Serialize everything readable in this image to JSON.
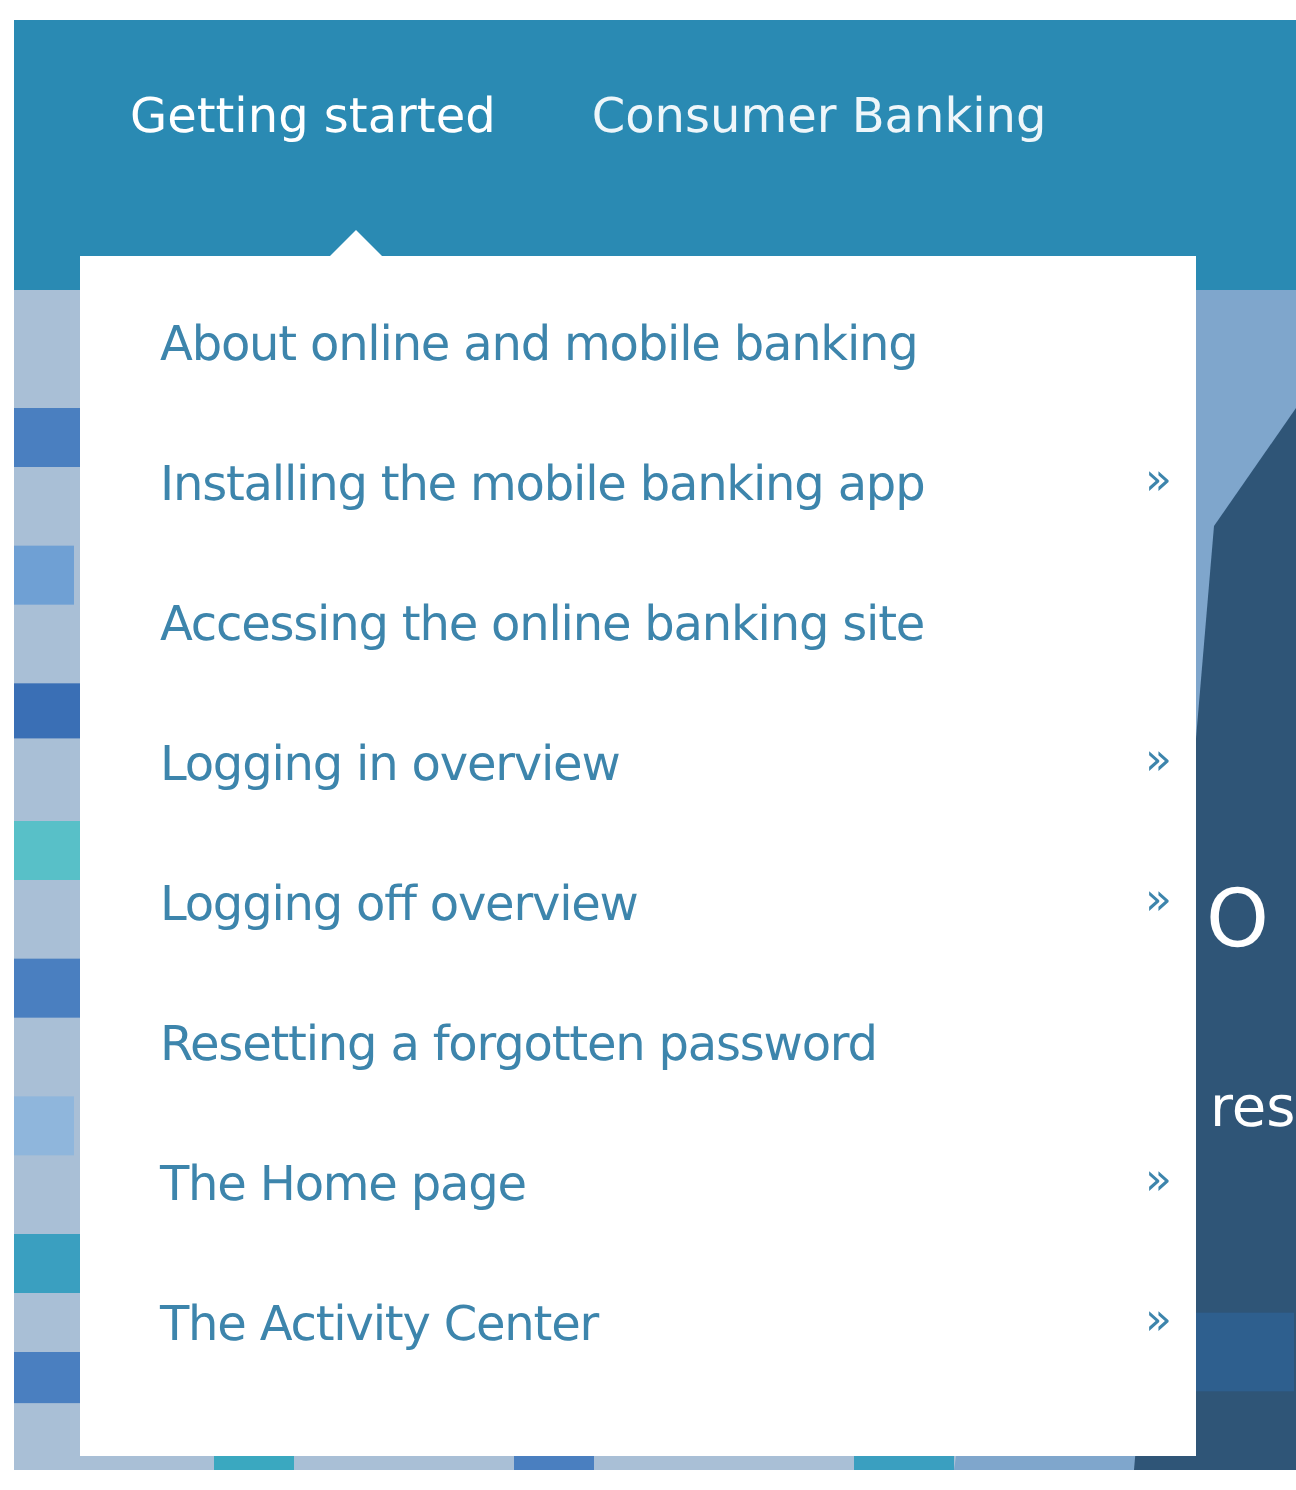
{
  "nav": {
    "tabs": [
      {
        "label": "Getting started",
        "selected": true
      },
      {
        "label": "Consumer Banking",
        "selected": false
      }
    ]
  },
  "hero": {
    "heading": "O",
    "subtext": "res"
  },
  "dropdown": {
    "items": [
      {
        "label": "About online and mobile banking"
      },
      {
        "label": "Installing the mobile banking app",
        "arrow": "»"
      },
      {
        "label": "Accessing the online banking site"
      },
      {
        "label": "Logging in overview",
        "arrow": "»"
      },
      {
        "label": "Logging off overview",
        "arrow": "»"
      },
      {
        "label": "Resetting a forgotten password"
      },
      {
        "label": "The Home page",
        "arrow": "»"
      },
      {
        "label": "The Activity Center",
        "arrow": "»"
      }
    ]
  }
}
